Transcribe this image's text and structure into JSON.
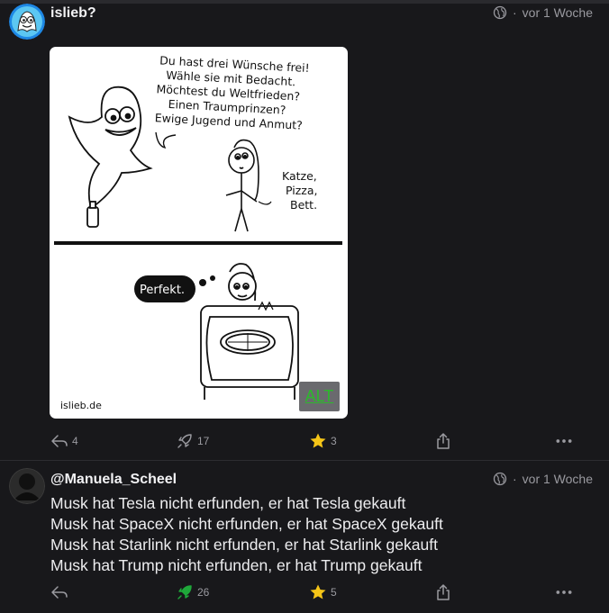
{
  "post1": {
    "author": "islieb?",
    "time": "vor 1 Woche",
    "image_alt_label": "ALT",
    "comic": {
      "speech1": [
        "Du hast drei Wünsche frei!",
        "Wähle sie mit Bedacht.",
        "Möchtest du Weltfrieden?",
        "Einen Traumprinzen?",
        "Ewige Jugend und Anmut?"
      ],
      "speech2": [
        "Katze,",
        "Pizza,",
        "Bett."
      ],
      "thought": "Perfekt.",
      "signature": "islieb.de"
    },
    "actions": {
      "replies": "4",
      "boosts": "17",
      "favourites": "3"
    }
  },
  "post2": {
    "author": "@Manuela_Scheel",
    "time": "vor 1 Woche",
    "lines": [
      "Musk hat Tesla nicht erfunden, er hat Tesla gekauft",
      "Musk hat SpaceX nicht erfunden, er hat SpaceX gekauft",
      "Musk hat Starlink nicht erfunden, er hat Starlink gekauft",
      "Musk hat Trump nicht erfunden, er hat Trump gekauft"
    ],
    "actions": {
      "replies": "",
      "boosts": "26",
      "favourites": "5"
    }
  },
  "colors": {
    "background": "#18181b",
    "boost_active": "#1fa83a",
    "star": "#f5c518",
    "alt_text": "#2cb92c"
  },
  "icons": [
    "globe-icon",
    "reply-icon",
    "boost-icon",
    "star-icon",
    "share-icon",
    "more-icon"
  ]
}
